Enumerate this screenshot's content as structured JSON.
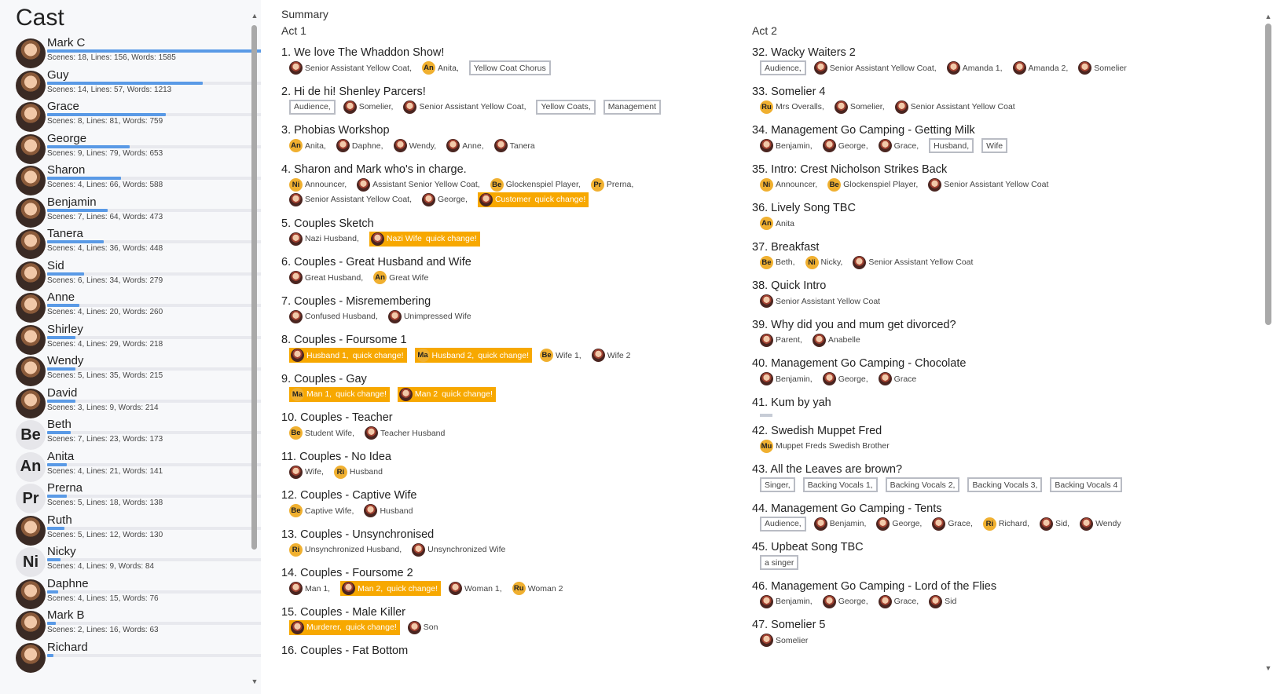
{
  "cast_title": "Cast",
  "cast": [
    {
      "name": "Mark C",
      "type": "photo",
      "stats": "Scenes: 18,  Lines: 156,  Words: 1585",
      "share": 1.0
    },
    {
      "name": "Guy",
      "type": "photo",
      "stats": "Scenes: 14,  Lines: 57,  Words: 1213",
      "share": 0.72
    },
    {
      "name": "Grace",
      "type": "photo",
      "stats": "Scenes: 8,  Lines: 81,  Words: 759",
      "share": 0.55
    },
    {
      "name": "George",
      "type": "photo",
      "stats": "Scenes: 9,  Lines: 79,  Words: 653",
      "share": 0.38
    },
    {
      "name": "Sharon",
      "type": "photo",
      "stats": "Scenes: 4,  Lines: 66,  Words: 588",
      "share": 0.34
    },
    {
      "name": "Benjamin",
      "type": "photo",
      "stats": "Scenes: 7,  Lines: 64,  Words: 473",
      "share": 0.28
    },
    {
      "name": "Tanera",
      "type": "photo",
      "stats": "Scenes: 4,  Lines: 36,  Words: 448",
      "share": 0.26
    },
    {
      "name": "Sid",
      "type": "photo",
      "stats": "Scenes: 6,  Lines: 34,  Words: 279",
      "share": 0.17
    },
    {
      "name": "Anne",
      "type": "photo",
      "stats": "Scenes: 4,  Lines: 20,  Words: 260",
      "share": 0.15
    },
    {
      "name": "Shirley",
      "type": "photo",
      "stats": "Scenes: 4,  Lines: 29,  Words: 218",
      "share": 0.13
    },
    {
      "name": "Wendy",
      "type": "photo",
      "stats": "Scenes: 5,  Lines: 35,  Words: 215",
      "share": 0.13
    },
    {
      "name": "David",
      "type": "photo",
      "stats": "Scenes: 3,  Lines: 9,  Words: 214",
      "share": 0.13
    },
    {
      "name": "Beth",
      "type": "initials",
      "initials": "Be",
      "stats": "Scenes: 7,  Lines: 23,  Words: 173",
      "share": 0.11
    },
    {
      "name": "Anita",
      "type": "initials",
      "initials": "An",
      "stats": "Scenes: 4,  Lines: 21,  Words: 141",
      "share": 0.09
    },
    {
      "name": "Prerna",
      "type": "initials",
      "initials": "Pr",
      "stats": "Scenes: 5,  Lines: 18,  Words: 138",
      "share": 0.09
    },
    {
      "name": "Ruth",
      "type": "photo",
      "stats": "Scenes: 5,  Lines: 12,  Words: 130",
      "share": 0.08
    },
    {
      "name": "Nicky",
      "type": "initials",
      "initials": "Ni",
      "stats": "Scenes: 4,  Lines: 9,  Words: 84",
      "share": 0.06
    },
    {
      "name": "Daphne",
      "type": "photo",
      "stats": "Scenes: 4,  Lines: 15,  Words: 76",
      "share": 0.05
    },
    {
      "name": "Mark B",
      "type": "photo",
      "stats": "Scenes: 2,  Lines: 16,  Words: 63",
      "share": 0.04
    },
    {
      "name": "Richard",
      "type": "photo",
      "stats": "",
      "share": 0.03
    }
  ],
  "summary_label": "Summary",
  "acts": [
    {
      "title": "Act 1",
      "scenes": [
        {
          "title": "1. We love The Whaddon Show!",
          "lines": [
            [
              {
                "t": "Senior Assistant Yellow Coat,",
                "i": "photo"
              },
              {
                "t": "Anita,",
                "i": "An"
              },
              {
                "t": "Yellow Coat Chorus",
                "box": true
              }
            ]
          ]
        },
        {
          "title": "2. Hi de hi! Shenley Parcers!",
          "lines": [
            [
              {
                "t": "Audience,",
                "box": true
              },
              {
                "t": "Somelier,",
                "i": "photo"
              },
              {
                "t": "Senior Assistant Yellow Coat,",
                "i": "photo"
              },
              {
                "t": "Yellow Coats,",
                "box": true
              },
              {
                "t": "Management",
                "box": true
              }
            ]
          ]
        },
        {
          "title": "3. Phobias Workshop",
          "lines": [
            [
              {
                "t": "Anita,",
                "i": "An"
              },
              {
                "t": "Daphne,",
                "i": "photo"
              },
              {
                "t": "Wendy,",
                "i": "photo"
              },
              {
                "t": "Anne,",
                "i": "photo"
              },
              {
                "t": "Tanera",
                "i": "photo"
              }
            ]
          ]
        },
        {
          "title": "4. Sharon and Mark who's in charge.",
          "lines": [
            [
              {
                "t": "Announcer,",
                "i": "Ni"
              },
              {
                "t": "Assistant Senior Yellow Coat,",
                "i": "photo"
              },
              {
                "t": "Glockenspiel Player,",
                "i": "Be"
              },
              {
                "t": "Prerna,",
                "i": "Pr"
              }
            ],
            [
              {
                "t": "Senior Assistant Yellow Coat,",
                "i": "photo"
              },
              {
                "t": "George,",
                "i": "photo"
              },
              {
                "t": "Customer",
                "i": "photo",
                "hl": true,
                "qc": "quick change!"
              }
            ]
          ]
        },
        {
          "title": "5. Couples Sketch",
          "lines": [
            [
              {
                "t": "Nazi Husband,",
                "i": "photo"
              },
              {
                "t": "Nazi Wife",
                "i": "photo",
                "hl": true,
                "qc": "quick change!"
              }
            ]
          ]
        },
        {
          "title": "6. Couples - Great Husband and Wife",
          "lines": [
            [
              {
                "t": "Great Husband,",
                "i": "photo"
              },
              {
                "t": "Great Wife",
                "i": "An"
              }
            ]
          ]
        },
        {
          "title": "7. Couples - Misremembering",
          "lines": [
            [
              {
                "t": "Confused Husband,",
                "i": "photo"
              },
              {
                "t": "Unimpressed Wife",
                "i": "photo"
              }
            ]
          ]
        },
        {
          "title": "8. Couples - Foursome 1",
          "lines": [
            [
              {
                "t": "Husband 1,",
                "i": "photo",
                "hl": true,
                "qc": "quick change!"
              },
              {
                "t": "Husband 2,",
                "i": "Ma",
                "hl": true,
                "qc": "quick change!"
              },
              {
                "t": "Wife 1,",
                "i": "Be"
              },
              {
                "t": "Wife 2",
                "i": "photo"
              }
            ]
          ]
        },
        {
          "title": "9. Couples - Gay",
          "lines": [
            [
              {
                "t": "Man 1,",
                "i": "Ma",
                "hl": true,
                "qc": "quick change!"
              },
              {
                "t": "Man 2",
                "i": "photo",
                "hl": true,
                "qc": "quick change!"
              }
            ]
          ]
        },
        {
          "title": "10. Couples - Teacher",
          "lines": [
            [
              {
                "t": "Student Wife,",
                "i": "Be"
              },
              {
                "t": "Teacher Husband",
                "i": "photo"
              }
            ]
          ]
        },
        {
          "title": "11. Couples - No Idea",
          "lines": [
            [
              {
                "t": "Wife,",
                "i": "photo"
              },
              {
                "t": "Husband",
                "i": "Ri"
              }
            ]
          ]
        },
        {
          "title": "12. Couples - Captive Wife",
          "lines": [
            [
              {
                "t": "Captive Wife,",
                "i": "Be"
              },
              {
                "t": "Husband",
                "i": "photo"
              }
            ]
          ]
        },
        {
          "title": "13. Couples - Unsynchronised",
          "lines": [
            [
              {
                "t": "Unsynchronized Husband,",
                "i": "Ri"
              },
              {
                "t": "Unsynchronized Wife",
                "i": "photo"
              }
            ]
          ]
        },
        {
          "title": "14. Couples - Foursome 2",
          "lines": [
            [
              {
                "t": "Man 1,",
                "i": "photo"
              },
              {
                "t": "Man 2,",
                "i": "photo",
                "hl": true,
                "qc": "quick change!"
              },
              {
                "t": "Woman 1,",
                "i": "photo"
              },
              {
                "t": "Woman 2",
                "i": "Ru"
              }
            ]
          ]
        },
        {
          "title": "15. Couples - Male Killer",
          "lines": [
            [
              {
                "t": "Murderer,",
                "i": "photo",
                "hl": true,
                "qc": "quick change!"
              },
              {
                "t": "Son",
                "i": "photo"
              }
            ]
          ]
        },
        {
          "title": "16. Couples - Fat Bottom",
          "lines": []
        }
      ]
    },
    {
      "title": "Act 2",
      "scenes": [
        {
          "title": "32. Wacky Waiters 2",
          "lines": [
            [
              {
                "t": "Audience,",
                "box": true
              },
              {
                "t": "Senior Assistant Yellow Coat,",
                "i": "photo"
              },
              {
                "t": "Amanda 1,",
                "i": "photo"
              },
              {
                "t": "Amanda 2,",
                "i": "photo"
              },
              {
                "t": "Somelier",
                "i": "photo"
              }
            ]
          ]
        },
        {
          "title": "33. Somelier 4",
          "lines": [
            [
              {
                "t": "Mrs Overalls,",
                "i": "Ru"
              },
              {
                "t": "Somelier,",
                "i": "photo"
              },
              {
                "t": "Senior Assistant Yellow Coat",
                "i": "photo"
              }
            ]
          ]
        },
        {
          "title": "34. Management Go Camping - Getting Milk",
          "lines": [
            [
              {
                "t": "Benjamin,",
                "i": "photo"
              },
              {
                "t": "George,",
                "i": "photo"
              },
              {
                "t": "Grace,",
                "i": "photo"
              },
              {
                "t": "Husband,",
                "box": true
              },
              {
                "t": "Wife",
                "box": true
              }
            ]
          ]
        },
        {
          "title": "35. Intro: Crest Nicholson Strikes Back",
          "lines": [
            [
              {
                "t": "Announcer,",
                "i": "Ni"
              },
              {
                "t": "Glockenspiel Player,",
                "i": "Be"
              },
              {
                "t": "Senior Assistant Yellow Coat",
                "i": "photo"
              }
            ]
          ]
        },
        {
          "title": "36. Lively Song TBC",
          "lines": [
            [
              {
                "t": "Anita",
                "i": "An"
              }
            ]
          ]
        },
        {
          "title": "37. Breakfast",
          "lines": [
            [
              {
                "t": "Beth,",
                "i": "Be"
              },
              {
                "t": "Nicky,",
                "i": "Ni"
              },
              {
                "t": "Senior Assistant Yellow Coat",
                "i": "photo"
              }
            ]
          ]
        },
        {
          "title": "38. Quick Intro",
          "lines": [
            [
              {
                "t": "Senior Assistant Yellow Coat",
                "i": "photo"
              }
            ]
          ]
        },
        {
          "title": "39. Why did you and mum get divorced?",
          "lines": [
            [
              {
                "t": "Parent,",
                "i": "photo"
              },
              {
                "t": "Anabelle",
                "i": "photo"
              }
            ]
          ]
        },
        {
          "title": "40. Management Go Camping - Chocolate",
          "lines": [
            [
              {
                "t": "Benjamin,",
                "i": "photo"
              },
              {
                "t": "George,",
                "i": "photo"
              },
              {
                "t": "Grace",
                "i": "photo"
              }
            ]
          ]
        },
        {
          "title": "41. Kum by yah",
          "lines": [],
          "empty": true
        },
        {
          "title": "42. Swedish Muppet Fred",
          "lines": [
            [
              {
                "t": "Muppet Freds Swedish Brother",
                "i": "Mu"
              }
            ]
          ]
        },
        {
          "title": "43. All the Leaves are brown?",
          "lines": [
            [
              {
                "t": "Singer,",
                "box": true
              },
              {
                "t": "Backing Vocals 1,",
                "box": true
              },
              {
                "t": "Backing Vocals 2,",
                "box": true
              },
              {
                "t": "Backing Vocals 3,",
                "box": true
              },
              {
                "t": "Backing Vocals 4",
                "box": true
              }
            ]
          ]
        },
        {
          "title": "44. Management Go Camping - Tents",
          "lines": [
            [
              {
                "t": "Audience,",
                "box": true
              },
              {
                "t": "Benjamin,",
                "i": "photo"
              },
              {
                "t": "George,",
                "i": "photo"
              },
              {
                "t": "Grace,",
                "i": "photo"
              },
              {
                "t": "Richard,",
                "i": "Ri"
              },
              {
                "t": "Sid,",
                "i": "photo"
              },
              {
                "t": "Wendy",
                "i": "photo"
              }
            ]
          ]
        },
        {
          "title": "45. Upbeat Song TBC",
          "lines": [
            [
              {
                "t": "a singer",
                "box": true
              }
            ]
          ]
        },
        {
          "title": "46. Management Go Camping - Lord of the Flies",
          "lines": [
            [
              {
                "t": "Benjamin,",
                "i": "photo"
              },
              {
                "t": "George,",
                "i": "photo"
              },
              {
                "t": "Grace,",
                "i": "photo"
              },
              {
                "t": "Sid",
                "i": "photo"
              }
            ]
          ]
        },
        {
          "title": "47. Somelier 5",
          "lines": [
            [
              {
                "t": "Somelier",
                "i": "photo"
              }
            ]
          ]
        }
      ]
    }
  ],
  "scroll_up_icon": "▲",
  "scroll_down_icon": "▼"
}
